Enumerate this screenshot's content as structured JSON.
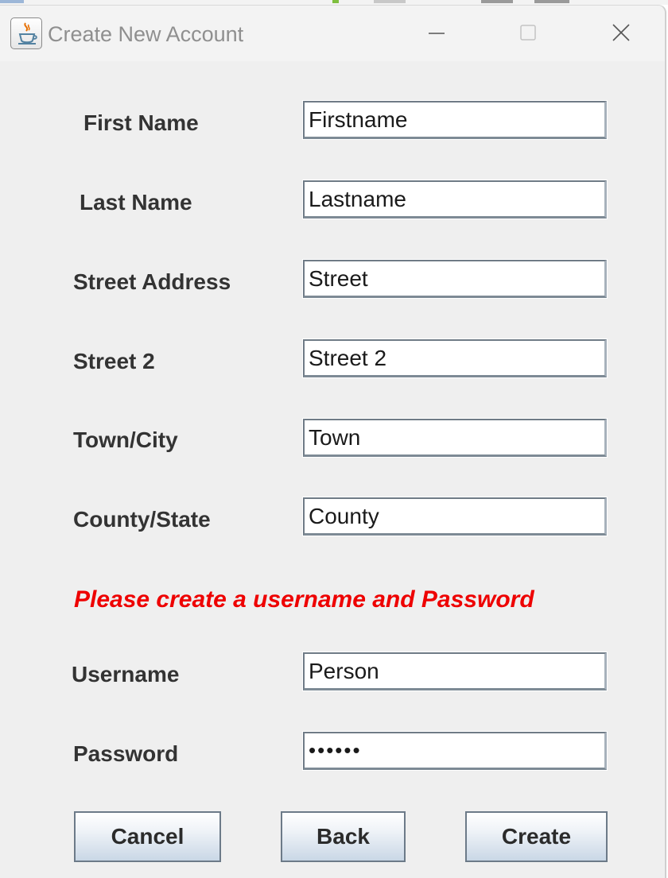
{
  "window": {
    "title": "Create New Account",
    "icon": "java-cup-icon"
  },
  "form": {
    "first_name": {
      "label": "First Name",
      "value": "Firstname"
    },
    "last_name": {
      "label": "Last Name",
      "value": "Lastname"
    },
    "street_address": {
      "label": "Street Address",
      "value": "Street"
    },
    "street2": {
      "label": "Street 2",
      "value": "Street 2"
    },
    "town": {
      "label": "Town/City",
      "value": "Town"
    },
    "county": {
      "label": "County/State",
      "value": "County"
    },
    "notice": "Please create a username and Password",
    "username": {
      "label": "Username",
      "value": "Person"
    },
    "password": {
      "label": "Password",
      "value": "••••••"
    }
  },
  "buttons": {
    "cancel": "Cancel",
    "back": "Back",
    "create": "Create"
  },
  "colors": {
    "notice": "#ee0000",
    "window_bg": "#efefef",
    "title_text": "#8f8f8f"
  }
}
